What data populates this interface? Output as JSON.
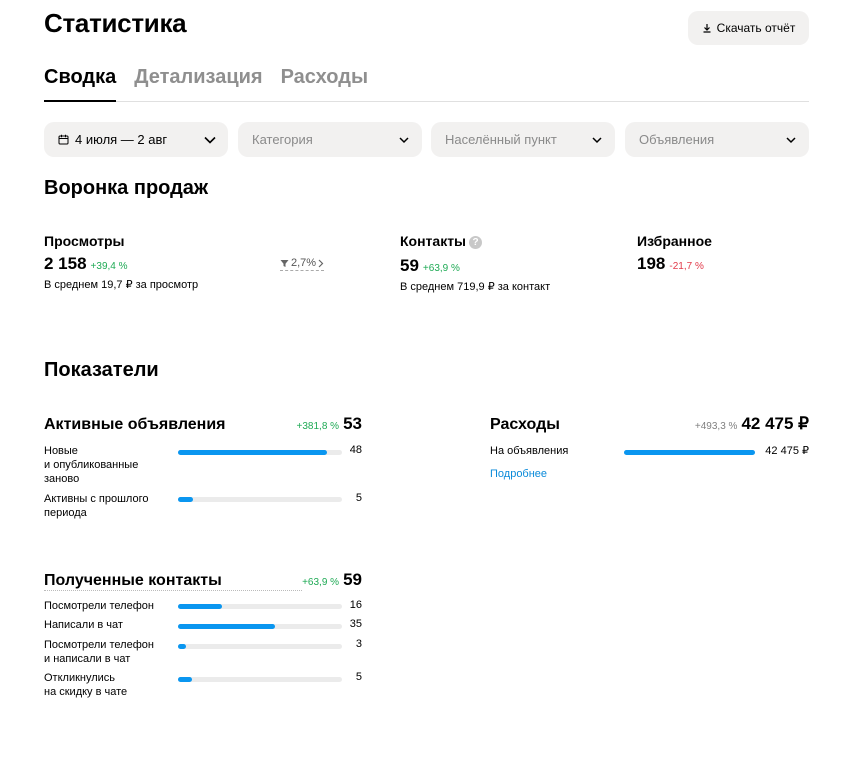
{
  "header": {
    "title": "Статистика",
    "download_label": "Скачать отчёт"
  },
  "tabs": [
    {
      "label": "Сводка",
      "active": true
    },
    {
      "label": "Детализация",
      "active": false
    },
    {
      "label": "Расходы",
      "active": false
    }
  ],
  "filters": {
    "date": "4 июля — 2 авг",
    "category": "Категория",
    "city": "Населённый пункт",
    "ads": "Объявления"
  },
  "funnel": {
    "title": "Воронка продаж",
    "views": {
      "label": "Просмотры",
      "value": "2 158",
      "change": "+39,4 %",
      "sub": "В среднем 19,7 ₽ за просмотр",
      "conversion": "2,7%"
    },
    "contacts": {
      "label": "Контакты",
      "help": "?",
      "value": "59",
      "change": "+63,9 %",
      "sub": "В среднем 719,9 ₽ за контакт"
    },
    "favorites": {
      "label": "Избранное",
      "value": "198",
      "change": "-21,7 %"
    }
  },
  "indicators": {
    "title": "Показатели",
    "active_ads": {
      "title": "Активные объявления",
      "change": "+381,8 %",
      "total": "53",
      "rows": [
        {
          "label": "Новые\nи опубликованные\nзаново",
          "value": "48",
          "fraction": 0.906
        },
        {
          "label": "Активны с прошлого\nпериода",
          "value": "5",
          "fraction": 0.094
        }
      ]
    },
    "expenses": {
      "title": "Расходы",
      "change": "+493,3 %",
      "total": "42 475 ₽",
      "rows": [
        {
          "label": "На объявления",
          "value": "42 475 ₽",
          "fraction": 1.0
        }
      ],
      "more_link": "Подробнее"
    },
    "contacts": {
      "title": "Полученные контакты",
      "change": "+63,9 %",
      "total": "59",
      "rows": [
        {
          "label": "Посмотрели телефон",
          "value": "16",
          "fraction": 0.271
        },
        {
          "label": "Написали в чат",
          "value": "35",
          "fraction": 0.593
        },
        {
          "label": "Посмотрели телефон\nи написали в чат",
          "value": "3",
          "fraction": 0.051
        },
        {
          "label": "Откликнулись\nна скидку в чате",
          "value": "5",
          "fraction": 0.085
        }
      ]
    }
  },
  "colors": {
    "accent": "#0a96f0",
    "positive": "#1faa55",
    "negative": "#e23a4a",
    "chip_bg": "#f2f1f0",
    "link": "#0a8ad9"
  },
  "icons": {
    "download": "download-icon",
    "calendar": "calendar-icon",
    "chevron": "chevron-down-icon",
    "funnel": "funnel-icon",
    "help": "question-icon"
  }
}
